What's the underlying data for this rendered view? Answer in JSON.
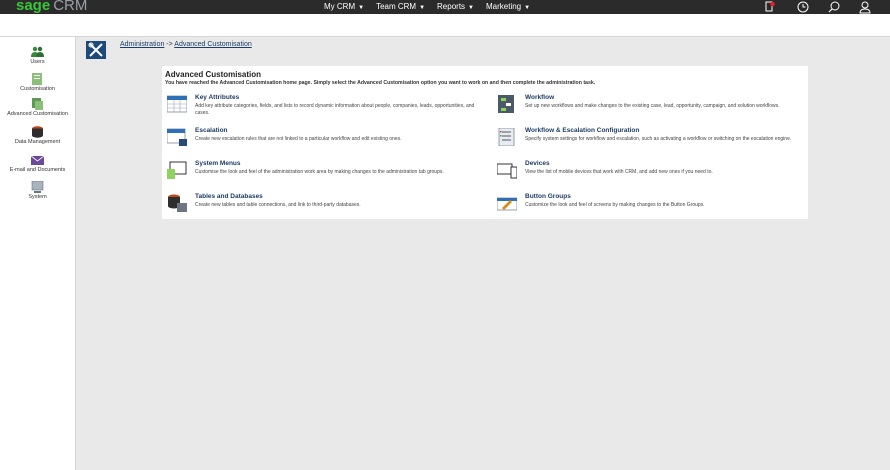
{
  "topbar": {
    "logo_sage": "sage",
    "logo_crm": "CRM",
    "nav": [
      {
        "label": "My CRM"
      },
      {
        "label": "Team CRM"
      },
      {
        "label": "Reports"
      },
      {
        "label": "Marketing"
      }
    ],
    "icons": [
      "notification-icon",
      "clock-icon",
      "search-icon",
      "user-icon"
    ]
  },
  "sidebar": {
    "items": [
      {
        "label": "Users",
        "icon": "users-icon"
      },
      {
        "label": "Customisation",
        "icon": "customisation-icon"
      },
      {
        "label": "Advanced Customisation",
        "icon": "advanced-customisation-icon"
      },
      {
        "label": "Data Management",
        "icon": "data-management-icon"
      },
      {
        "label": "E-mail and Documents",
        "icon": "email-icon"
      },
      {
        "label": "System",
        "icon": "system-icon"
      }
    ]
  },
  "breadcrumb": {
    "root": "Administration",
    "separator": " -> ",
    "current": "Advanced Customisation"
  },
  "panel": {
    "title": "Advanced Customisation",
    "subtitle": "You have reached the Advanced Customisation home page. Simply select the Advanced Customisation option you want to work on and then complete the administration task.",
    "options": [
      {
        "title": "Key Attributes",
        "desc": "Add key attribute categories, fields, and lists to record dynamic information about people, companies, leads, opportunities, and cases.",
        "icon": "key-attributes-icon"
      },
      {
        "title": "Workflow",
        "desc": "Set up new workflows and make changes to the existing case, lead, opportunity, campaign, and solution workflows.",
        "icon": "workflow-icon"
      },
      {
        "title": "Escalation",
        "desc": "Create new escalation rules that are not linked to a particular workflow and edit existing ones.",
        "icon": "escalation-icon"
      },
      {
        "title": "Workflow & Escalation Configuration",
        "desc": "Specify system settings for workflow and escalation, such as activating a workflow or switching on the escalation engine.",
        "icon": "workflow-configuration-icon"
      },
      {
        "title": "System Menus",
        "desc": "Customise the look and feel of the administration work area by making changes to the administration tab groups.",
        "icon": "system-menus-icon"
      },
      {
        "title": "Devices",
        "desc": "View the list of mobile devices that work with CRM, and add new ones if you need to.",
        "icon": "devices-icon"
      },
      {
        "title": "Tables and Databases",
        "desc": "Create new tables and table connections, and link to third-party databases.",
        "icon": "tables-databases-icon"
      },
      {
        "title": "Button Groups",
        "desc": "Customize the look and feel of screens by making changes to the Button Groups.",
        "icon": "button-groups-icon"
      }
    ]
  },
  "colors": {
    "topbar": "#2b2b2b",
    "brand_green": "#37c737",
    "link_blue": "#1a3d6b",
    "badge_blue": "#1e4a7a"
  }
}
